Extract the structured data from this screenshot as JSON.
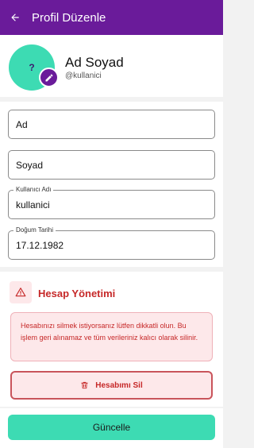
{
  "appbar": {
    "title": "Profil Düzenle",
    "back_icon": "arrow-left-icon"
  },
  "profile": {
    "avatar_initial": "?",
    "name": "Ad Soyad",
    "username": "@kullanici",
    "edit_icon": "pencil-icon"
  },
  "form": {
    "first_name": {
      "placeholder": "Ad",
      "value": ""
    },
    "last_name": {
      "placeholder": "Soyad",
      "value": ""
    },
    "username": {
      "label": "Kullanıcı Adı",
      "value": "kullanici"
    },
    "birth_date": {
      "label": "Doğum Tarihi",
      "value": "17.12.1982"
    }
  },
  "account": {
    "title": "Hesap Yönetimi",
    "warning_icon": "warning-triangle-icon",
    "notice": "Hesabınızı silmek istiyorsanız lütfen dikkatli olun. Bu işlem geri alınamaz ve tüm verileriniz kalıcı olarak silinir.",
    "delete_label": "Hesabımı Sil",
    "delete_icon": "trash-icon"
  },
  "footer": {
    "update_label": "Güncelle"
  },
  "colors": {
    "primary": "#6a1b9a",
    "accent": "#3ddbb3",
    "danger": "#c62828",
    "danger_bg": "#fde8ea"
  }
}
